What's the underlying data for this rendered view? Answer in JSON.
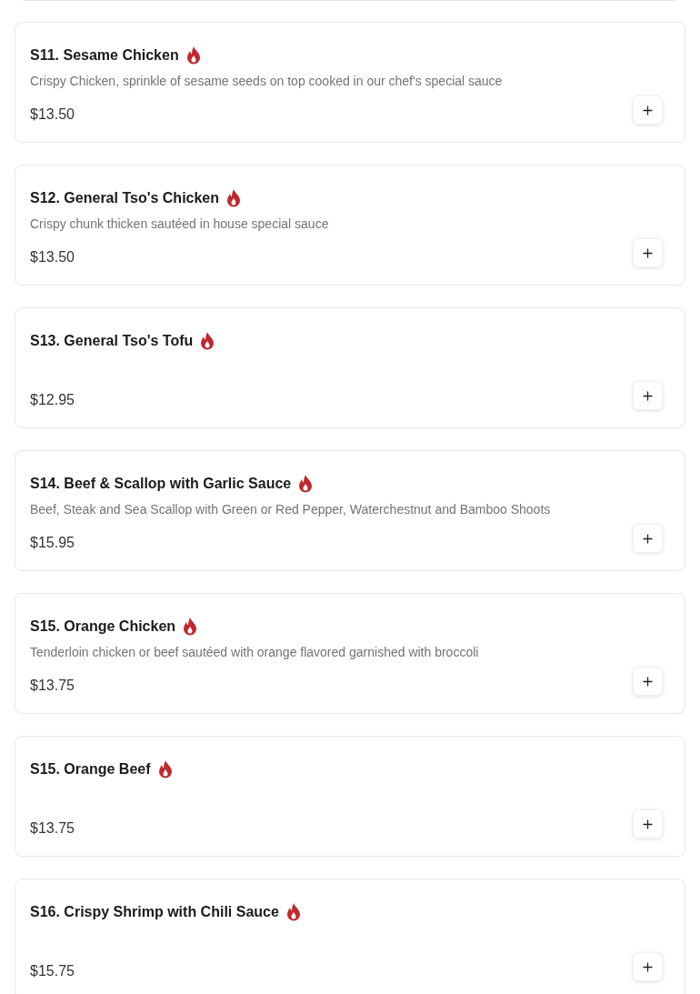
{
  "items": [
    {
      "title": "S11. Sesame Chicken",
      "spicy": true,
      "description": "Crispy Chicken, sprinkle of sesame seeds on top cooked in our chef's special sauce",
      "price": "$13.50"
    },
    {
      "title": "S12. General Tso's Chicken",
      "spicy": true,
      "description": "Crispy chunk thicken sautéed in house special sauce",
      "price": "$13.50"
    },
    {
      "title": "S13. General Tso's Tofu",
      "spicy": true,
      "price": "$12.95"
    },
    {
      "title": "S14. Beef & Scallop with Garlic Sauce",
      "spicy": true,
      "description": "Beef, Steak and Sea Scallop with Green or Red Pepper, Waterchestnut and Bamboo Shoots",
      "price": "$15.95"
    },
    {
      "title": "S15. Orange Chicken",
      "spicy": true,
      "description": "Tenderloin chicken or beef sautéed with orange flavored garnished with broccoli",
      "price": "$13.75"
    },
    {
      "title": "S15. Orange Beef",
      "spicy": true,
      "price": "$13.75"
    },
    {
      "title": "S16. Crispy Shrimp with Chili Sauce",
      "spicy": true,
      "price": "$15.75"
    }
  ]
}
